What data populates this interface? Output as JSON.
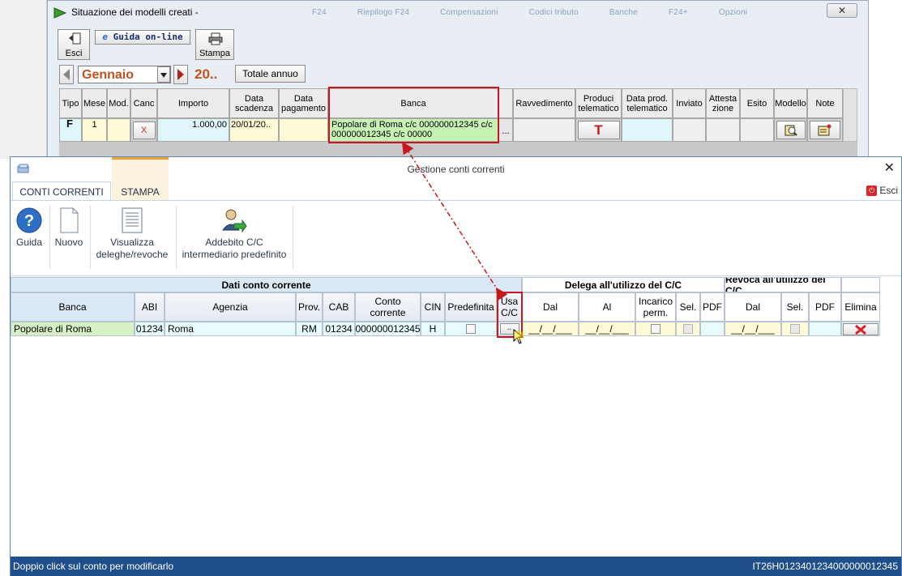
{
  "background_window": {
    "title": "Situazione dei modelli creati -",
    "ghost_menu": [
      "F24",
      "Riepilogo F24",
      "Compensazioni",
      "Codici tributo",
      "Banche",
      "F24+",
      "Opzioni"
    ],
    "close_symbol": "✕",
    "toolbar": {
      "exit_label": "Esci",
      "guide_label": "Guida on-line",
      "print_label": "Stampa",
      "month": "Gennaio",
      "year": "20..",
      "annual_total_label": "Totale annuo"
    },
    "table": {
      "headers": [
        "Tipo",
        "Mese",
        "Mod.",
        "Canc",
        "Importo",
        "Data scadenza",
        "Data pagamento",
        "Banca",
        "",
        "Ravvedimento",
        "Produci telematico",
        "Data prod. telematico",
        "Inviato",
        "Attesta zione",
        "Esito",
        "Modello",
        "Note"
      ],
      "row": {
        "tipo": "F",
        "mese": "1",
        "canc": "X",
        "importo": "1.000,00",
        "data_scadenza": "20/01/20..",
        "banca": "Popolare di Roma c/c 000000012345 c/c 000000012345 c/c 00000",
        "ellipsis": "...",
        "produci_icon": "T"
      }
    }
  },
  "front_window": {
    "title": "Gestione conti correnti",
    "close_symbol": "✕",
    "tabs": [
      "CONTI CORRENTI",
      "STAMPA"
    ],
    "exit_label": "Esci",
    "ribbon": {
      "guida": "Guida",
      "nuovo": "Nuovo",
      "visualizza_line1": "Visualizza",
      "visualizza_line2": "deleghe/revoche",
      "addebito_line1": "Addebito C/C",
      "addebito_line2": "intermediario predefinito"
    },
    "grid": {
      "group_dati": "Dati conto corrente",
      "group_delega": "Delega all'utilizzo del C/C",
      "group_revoca": "Revoca all'utilizzo del C/C",
      "headers": {
        "banca": "Banca",
        "abi": "ABI",
        "agenzia": "Agenzia",
        "prov": "Prov.",
        "cab": "CAB",
        "conto_l1": "Conto",
        "conto_l2": "corrente",
        "cin": "CIN",
        "predefinita": "Predefinita",
        "usa_l1": "Usa",
        "usa_l2": "C/C",
        "dal": "Dal",
        "al": "Al",
        "incarico_l1": "Incarico",
        "incarico_l2": "perm.",
        "sel": "Sel.",
        "pdf": "PDF",
        "rdal": "Dal",
        "rsel": "Sel.",
        "rpdf": "PDF",
        "elimina": "Elimina"
      },
      "row": {
        "banca": "Popolare di Roma",
        "abi": "01234",
        "agenzia": "Roma",
        "prov": "RM",
        "cab": "01234",
        "conto": "000000012345",
        "cin": "H",
        "usa": "..",
        "dal": "__/__/___",
        "al": "__/__/___",
        "rdal": "__/__/___"
      }
    },
    "status_left": "Doppio click sul conto per modificarlo",
    "status_right": "IT26H0123401234000000012345"
  },
  "colors": {
    "highlight_red": "#c8171e",
    "bank_green": "#c6f2b4",
    "status_blue": "#1f4e8c",
    "month_orange": "#c0531d"
  }
}
